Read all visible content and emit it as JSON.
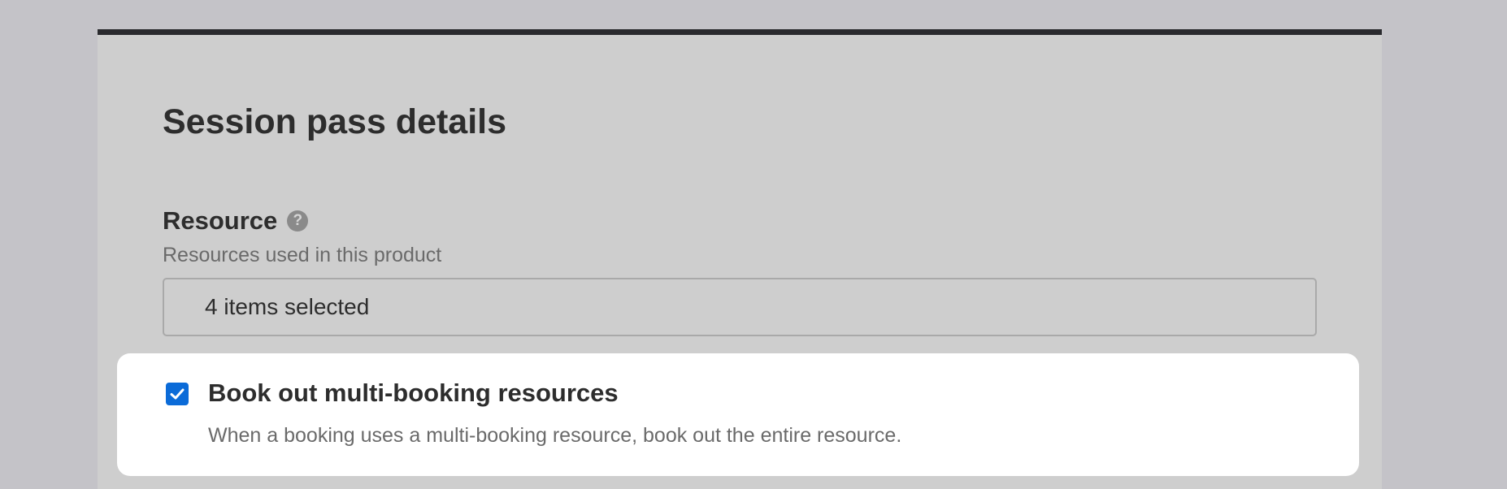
{
  "section": {
    "title": "Session pass details"
  },
  "resource_field": {
    "label": "Resource",
    "help_icon": "question-mark-icon",
    "help_glyph": "?",
    "description": "Resources used in this product",
    "selected_value": "4 items selected"
  },
  "multi_booking_option": {
    "checked": true,
    "label": "Book out multi-booking resources",
    "description": "When a booking uses a multi-booking resource, book out the entire resource.",
    "check_icon": "checkmark-icon"
  },
  "colors": {
    "accent": "#0b6bd8",
    "card_background": "#cecece",
    "page_background": "#c4c3c8",
    "card_top_border": "#2a2a2e",
    "highlight_panel": "#ffffff"
  }
}
